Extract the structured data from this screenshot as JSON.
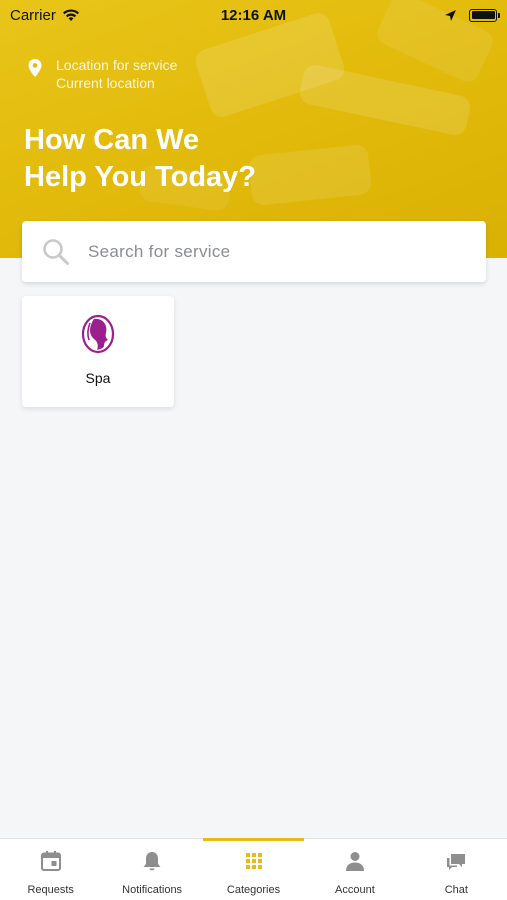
{
  "status_bar": {
    "carrier": "Carrier",
    "time": "12:16 AM"
  },
  "location": {
    "label": "Location for service",
    "value": "Current location"
  },
  "headline": {
    "line1": "How Can We",
    "line2": "Help You Today?"
  },
  "search": {
    "placeholder": "Search for service"
  },
  "categories": [
    {
      "label": "Spa",
      "icon": "spa-face-icon",
      "color": "#9b1f8f"
    }
  ],
  "tabs": [
    {
      "label": "Requests",
      "icon": "calendar-icon",
      "active": false
    },
    {
      "label": "Notifications",
      "icon": "bell-icon",
      "active": false
    },
    {
      "label": "Categories",
      "icon": "grid-icon",
      "active": true
    },
    {
      "label": "Account",
      "icon": "person-icon",
      "active": false
    },
    {
      "label": "Chat",
      "icon": "chat-icon",
      "active": false
    }
  ],
  "colors": {
    "accent": "#e8bd10",
    "header": "#e2bb0c",
    "inactive_icon": "#8e8e8e"
  }
}
